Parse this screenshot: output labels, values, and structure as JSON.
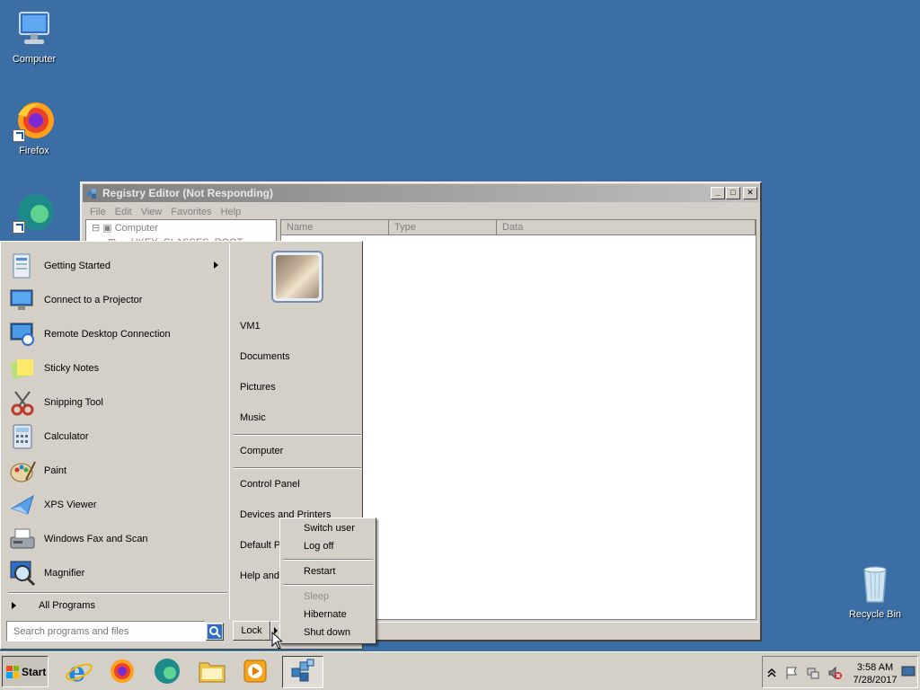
{
  "desktop": {
    "icons": [
      {
        "label": "Computer"
      },
      {
        "label": "Firefox"
      },
      {
        "label": "Recycle Bin"
      }
    ]
  },
  "window": {
    "title": "Registry Editor (Not Responding)",
    "menu": [
      "File",
      "Edit",
      "View",
      "Favorites",
      "Help"
    ],
    "tree": [
      "Computer",
      "HKEY_CLASSES_ROOT"
    ],
    "columns": [
      "Name",
      "Type",
      "Data"
    ]
  },
  "start_menu": {
    "programs": [
      {
        "label": "Getting Started",
        "has_submenu": true
      },
      {
        "label": "Connect to a Projector"
      },
      {
        "label": "Remote Desktop Connection"
      },
      {
        "label": "Sticky Notes"
      },
      {
        "label": "Snipping Tool"
      },
      {
        "label": "Calculator"
      },
      {
        "label": "Paint"
      },
      {
        "label": "XPS Viewer"
      },
      {
        "label": "Windows Fax and Scan"
      },
      {
        "label": "Magnifier"
      }
    ],
    "all_programs": "All Programs",
    "search_placeholder": "Search programs and files",
    "right_links": [
      {
        "label": "VM1"
      },
      {
        "label": "Documents"
      },
      {
        "label": "Pictures"
      },
      {
        "label": "Music"
      },
      {
        "label": "Computer"
      },
      {
        "label": "Control Panel"
      },
      {
        "label": "Devices and Printers"
      },
      {
        "label": "Default P"
      },
      {
        "label": "Help and"
      }
    ],
    "lock_label": "Lock"
  },
  "power_menu": {
    "items": [
      {
        "label": "Switch user",
        "enabled": true
      },
      {
        "label": "Log off",
        "enabled": true
      },
      {
        "label": "Restart",
        "enabled": true
      },
      {
        "label": "Sleep",
        "enabled": false
      },
      {
        "label": "Hibernate",
        "enabled": true
      },
      {
        "label": "Shut down",
        "enabled": true
      }
    ]
  },
  "taskbar": {
    "start_label": "Start",
    "pinned": [
      "internet-explorer-icon",
      "firefox-icon",
      "edge-icon",
      "file-explorer-icon",
      "media-player-icon",
      "registry-editor-icon"
    ],
    "clock_time": "3:58 AM",
    "clock_date": "7/28/2017"
  },
  "colors": {
    "desktop": "#3a6ea5",
    "chrome": "#d4d0c8"
  }
}
